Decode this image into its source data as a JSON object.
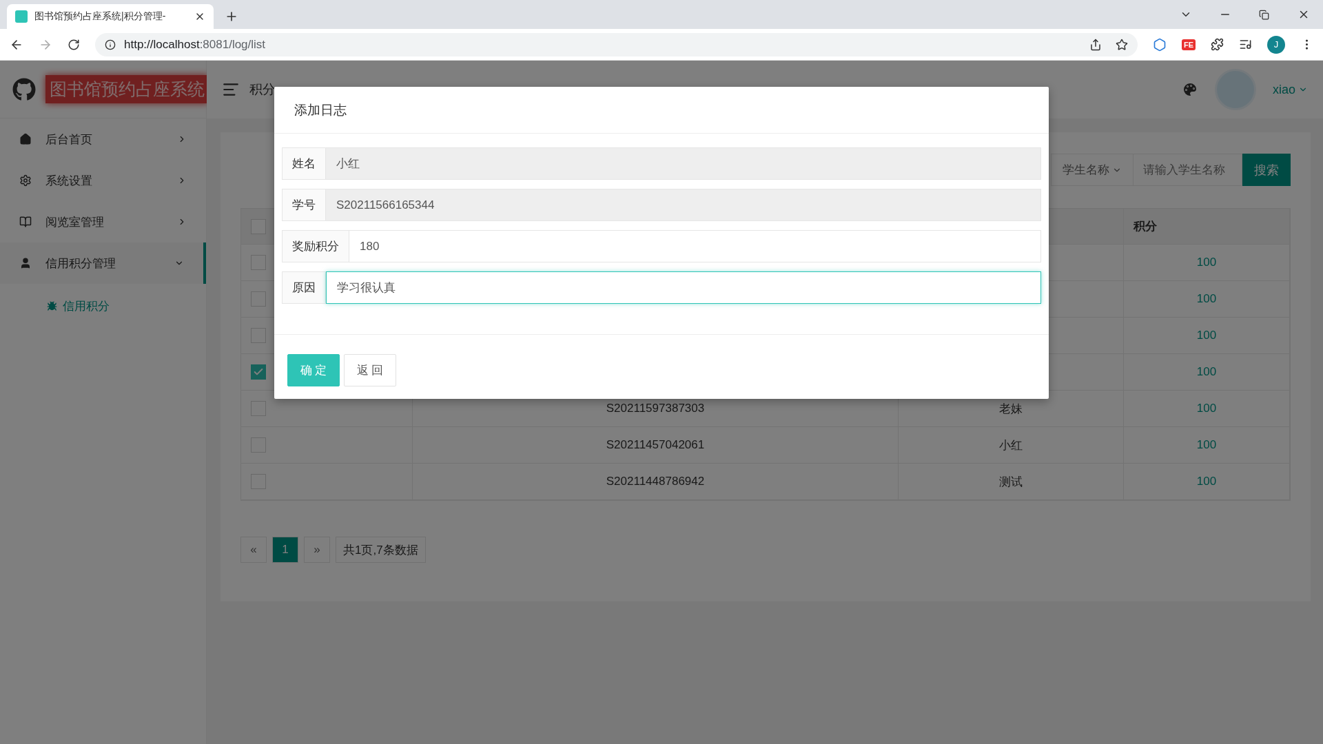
{
  "browser": {
    "tab_title": "图书馆预约占座系统|积分管理-",
    "url_host": "http://localhost",
    "url_rest": ":8081/log/list",
    "extension_badge": "FE",
    "profile_initial": "J"
  },
  "sidebar": {
    "app_title": "图书馆预约占座系统",
    "items": [
      {
        "kind": "home",
        "label": "后台首页",
        "expanded": false
      },
      {
        "kind": "settings",
        "label": "系统设置",
        "expanded": false
      },
      {
        "kind": "book",
        "label": "阅览室管理",
        "expanded": false
      },
      {
        "kind": "user",
        "label": "信用积分管理",
        "expanded": true,
        "children": [
          {
            "label": "信用积分",
            "selected": true
          }
        ]
      }
    ]
  },
  "header": {
    "title": "积分",
    "user": "xiao"
  },
  "search": {
    "field_select": "学生名称",
    "placeholder": "请输入学生名称",
    "button": "搜索"
  },
  "table": {
    "header_checked": false,
    "columns": [
      {
        "label": "积分"
      }
    ],
    "rows": [
      {
        "checked": false,
        "points": "100"
      },
      {
        "checked": false,
        "points": "100"
      },
      {
        "checked": false,
        "points": "100"
      },
      {
        "checked": true,
        "points": "100"
      },
      {
        "checked": false,
        "student_id": "S20211597387303",
        "name": "老妹",
        "points": "100"
      },
      {
        "checked": false,
        "student_id": "S20211457042061",
        "name": "小红",
        "points": "100"
      },
      {
        "checked": false,
        "student_id": "S20211448786942",
        "name": "测试",
        "points": "100"
      }
    ]
  },
  "pagination": {
    "prev": "«",
    "pages": [
      {
        "label": "1",
        "selected": true
      }
    ],
    "next": "»",
    "summary": "共1页,7条数据"
  },
  "dialog": {
    "title": "添加日志",
    "fields": [
      {
        "label": "姓名",
        "value": "小红",
        "disabled": true,
        "focused": false
      },
      {
        "label": "学号",
        "value": "S20211566165344",
        "disabled": true,
        "focused": false
      },
      {
        "label": "奖励积分",
        "value": "180",
        "disabled": false,
        "focused": false
      },
      {
        "label": "原因",
        "value": "学习很认真",
        "disabled": false,
        "focused": true
      }
    ],
    "buttons": [
      {
        "kind": "primary",
        "label": "确 定"
      },
      {
        "kind": "default",
        "label": "返 回"
      }
    ]
  }
}
